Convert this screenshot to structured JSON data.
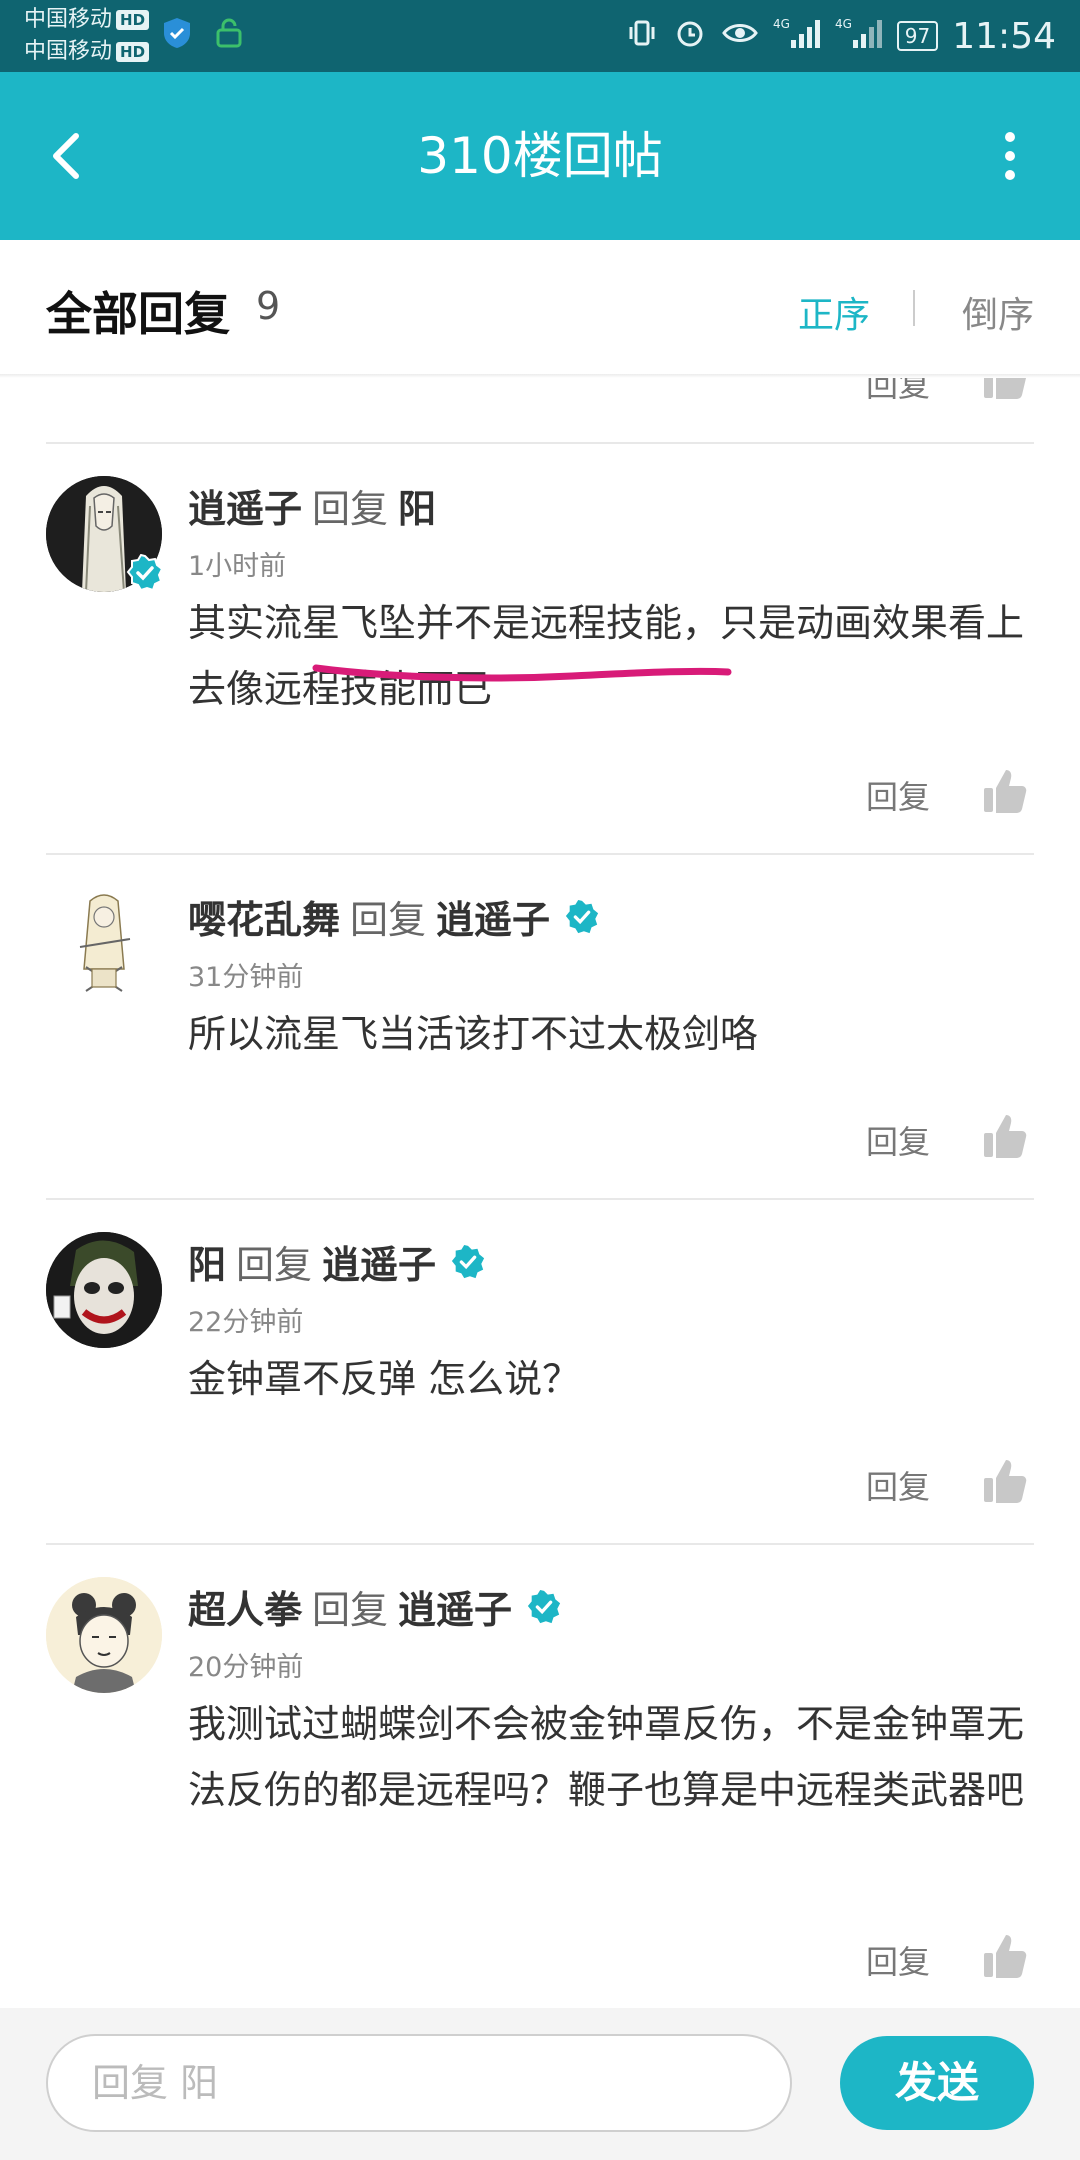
{
  "status_bar": {
    "carrier1": "中国移动",
    "carrier2": "中国移动",
    "hd": "HD",
    "network": "4G",
    "battery": "97",
    "time": "11:54"
  },
  "header": {
    "title": "310楼回帖"
  },
  "replies_header": {
    "title": "全部回复",
    "count": "9",
    "sort_asc": "正序",
    "sort_desc": "倒序"
  },
  "reply_label": "回复",
  "colors": {
    "accent": "#1db6c6",
    "status_bar": "#0f6470",
    "underline": "#d81b78"
  },
  "comments": [
    {
      "author": "逍遥子",
      "reply_word": "回复",
      "target": "阳",
      "time": "1小时前",
      "text": "其实流星飞坠并不是远程技能，只是动画效果看上去像远程技能而已",
      "avatar_icon": "character-avatar-icon"
    },
    {
      "author": "嘤花乱舞",
      "reply_word": "回复",
      "target": "逍遥子",
      "time": "31分钟前",
      "text": "所以流星飞当活该打不过太极剑咯",
      "avatar_icon": "character-avatar-icon"
    },
    {
      "author": "阳",
      "reply_word": "回复",
      "target": "逍遥子",
      "time": "22分钟前",
      "text": "金钟罩不反弹 怎么说？",
      "avatar_icon": "joker-avatar-icon"
    },
    {
      "author": "超人拳",
      "reply_word": "回复",
      "target": "逍遥子",
      "time": "20分钟前",
      "text": "我测试过蝴蝶剑不会被金钟罩反伤，不是金钟罩无法反伤的都是远程吗？鞭子也算是中远程类武器吧",
      "avatar_icon": "character-avatar-icon"
    }
  ],
  "bottom_bar": {
    "input_placeholder": "回复 阳",
    "send_label": "发送"
  }
}
